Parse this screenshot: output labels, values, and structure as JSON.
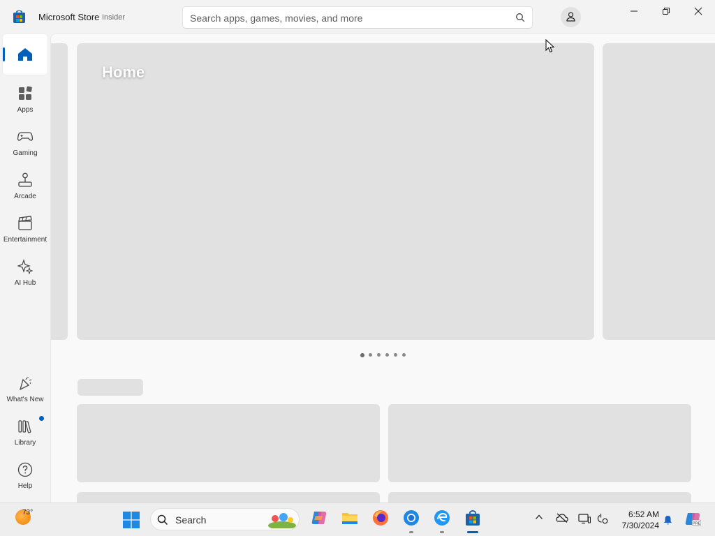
{
  "window": {
    "title": "Microsoft Store",
    "badge": "Insider",
    "search_placeholder": "Search apps, games, movies, and more"
  },
  "sidebar": {
    "home": "Home",
    "apps": "Apps",
    "gaming": "Gaming",
    "arcade": "Arcade",
    "entertainment": "Entertainment",
    "ai_hub": "AI Hub",
    "whats_new": "What's New",
    "library": "Library",
    "help": "Help"
  },
  "hero": {
    "title": "Home",
    "page_count": 6,
    "active_page": 1
  },
  "taskbar": {
    "weather_temp": "73°",
    "search_placeholder": "Search",
    "time": "6:52 AM",
    "date": "7/30/2024"
  },
  "colors": {
    "accent": "#005fb8",
    "placeholder_block": "#e1e1e1"
  }
}
